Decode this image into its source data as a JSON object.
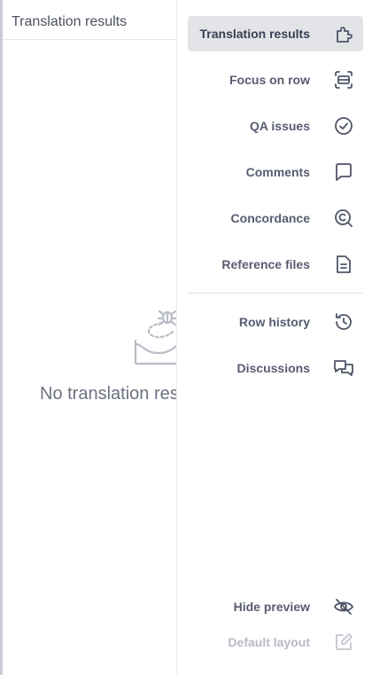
{
  "left_panel": {
    "header": "Translation results",
    "empty_message": "No translation results"
  },
  "menu": {
    "items": [
      {
        "label": "Translation results",
        "icon": "puzzle-icon",
        "active": true
      },
      {
        "label": "Focus on row",
        "icon": "focus-row-icon"
      },
      {
        "label": "QA issues",
        "icon": "check-circle-icon"
      },
      {
        "label": "Comments",
        "icon": "comment-icon"
      },
      {
        "label": "Concordance",
        "icon": "concordance-search-icon"
      },
      {
        "label": "Reference files",
        "icon": "file-icon"
      },
      {
        "label": "Row history",
        "icon": "history-icon"
      },
      {
        "label": "Discussions",
        "icon": "discussions-icon"
      }
    ],
    "bottom_items": [
      {
        "label": "Hide preview",
        "icon": "eye-off-icon"
      },
      {
        "label": "Default layout",
        "icon": "edit-layout-icon",
        "disabled": true
      }
    ]
  },
  "colors": {
    "active_bg": "#e3e4e8",
    "text": "#575c70",
    "disabled_text": "#b7bac5",
    "icon": "#4f5468"
  }
}
